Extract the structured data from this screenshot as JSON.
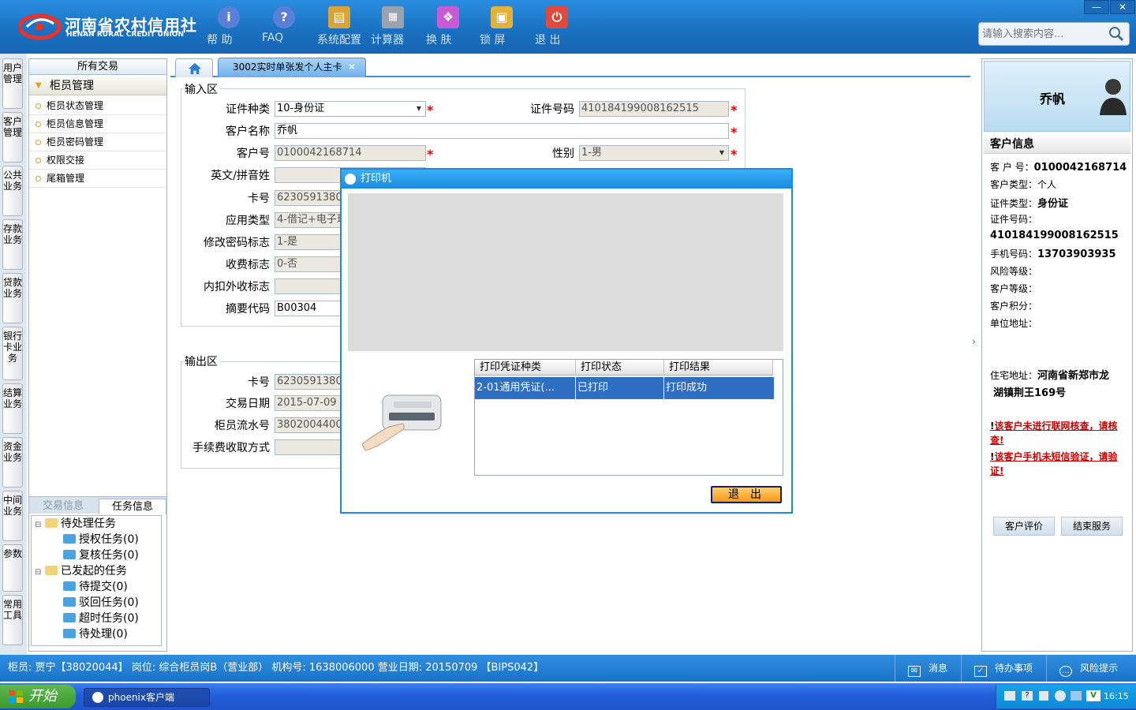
{
  "header": {
    "logo_cn": "河南省农村信用社",
    "logo_en": "HENAN RURAL CREDIT UNION",
    "toolbar": [
      {
        "label": "帮 助",
        "icon": "help-icon"
      },
      {
        "label": "FAQ",
        "icon": "faq-icon"
      },
      {
        "label": "系统配置",
        "icon": "config-icon"
      },
      {
        "label": "计算器",
        "icon": "calculator-icon"
      },
      {
        "label": "换 肤",
        "icon": "skin-icon"
      },
      {
        "label": "锁 屏",
        "icon": "lock-icon"
      },
      {
        "label": "退 出",
        "icon": "exit-icon"
      }
    ],
    "search_placeholder": "请输入搜索内容...",
    "window_controls": {
      "minimize": "—",
      "close": "✕"
    }
  },
  "vtabs": [
    "用户管理",
    "客户管理",
    "公共业务",
    "存款业务",
    "贷款业务",
    "银行卡业务",
    "结算业务",
    "资金业务",
    "中间业务",
    "参数",
    "常用工具"
  ],
  "left_panel": {
    "header": "所有交易",
    "group": "柜员管理",
    "items": [
      "柜员状态管理",
      "柜员信息管理",
      "柜员密码管理",
      "权限交接",
      "尾箱管理"
    ],
    "tabs": [
      "交易信息",
      "任务信息"
    ],
    "tree": {
      "pending": "待处理任务",
      "pending_children": [
        "授权任务(0)",
        "复核任务(0)"
      ],
      "initiated": "已发起的任务",
      "initiated_children": [
        "待提交(0)",
        "驳回任务(0)",
        "超时任务(0)",
        "待处理(0)"
      ]
    }
  },
  "tabs": {
    "active": "3002实时单张发个人主卡",
    "close": "✕"
  },
  "input_area": {
    "legend": "输入区",
    "id_type_label": "证件种类",
    "id_type_value": "10-身份证",
    "id_no_label": "证件号码",
    "id_no_value": "410184199008162515",
    "name_label": "客户名称",
    "name_value": "乔帆",
    "cust_no_label": "客户号",
    "cust_no_value": "0100042168714",
    "gender_label": "性别",
    "gender_value": "1-男",
    "pinyin_label": "英文/拼音姓",
    "pinyin_value": "",
    "card_label": "卡号",
    "card_value": "62305913800",
    "app_type_label": "应用类型",
    "app_type_value": "4-借记+电子现",
    "pwd_flag_label": "修改密码标志",
    "pwd_flag_value": "1-是",
    "fee_flag_label": "收费标志",
    "fee_flag_value": "0-否",
    "inout_label": "内扣外收标志",
    "inout_value": "",
    "summary_label": "摘要代码",
    "summary_value": "B00304",
    "required_mark": "*"
  },
  "output_area": {
    "legend": "输出区",
    "card_label": "卡号",
    "card_value": "62305913800",
    "date_label": "交易日期",
    "date_value": "2015-07-09",
    "serial_label": "柜员流水号",
    "serial_value": "38020044000",
    "fee_mode_label": "手续费收取方式",
    "fee_mode_value": ""
  },
  "dialog": {
    "title": "打印机",
    "columns": [
      "打印凭证种类",
      "打印状态",
      "打印结果"
    ],
    "rows": [
      [
        "2-01通用凭证(...",
        "已打印",
        "打印成功"
      ]
    ],
    "exit_label": "退出"
  },
  "right_panel": {
    "customer_name": "乔帆",
    "section_title": "客户信息",
    "fields": {
      "cust_no_label": "客 户 号：",
      "cust_no": "0100042168714",
      "cust_type_label": "客户类型：",
      "cust_type": "个人",
      "id_type_label": "证件类型：",
      "id_type": "身份证",
      "id_no_label": "证件号码：",
      "id_no": "410184199008162515",
      "phone_label": "手机号码：",
      "phone": "13703903935",
      "risk_label": "风险等级：",
      "level_label": "客户等级：",
      "points_label": "客户积分：",
      "company_label": "单位地址：",
      "address_label": "住宅地址：",
      "address_1": "河南省新郑市龙",
      "address_2": "湖镇荆王169号"
    },
    "warnings": [
      "该客户未进行联网核查，请核查!",
      "该客户手机未短信验证，请验证!"
    ],
    "buttons": [
      "客户评价",
      "结束服务"
    ]
  },
  "status_bar": {
    "text": "柜员: 贾宁【38020044】 岗位: 综合柜员岗B（营业部） 机构号: 1638006000  营业日期: 20150709 【BIPS042】",
    "buttons": [
      "消息",
      "待办事项",
      "风险提示"
    ]
  },
  "taskbar": {
    "start": "开始",
    "task": "phoenix客户端",
    "time": "16:15"
  }
}
